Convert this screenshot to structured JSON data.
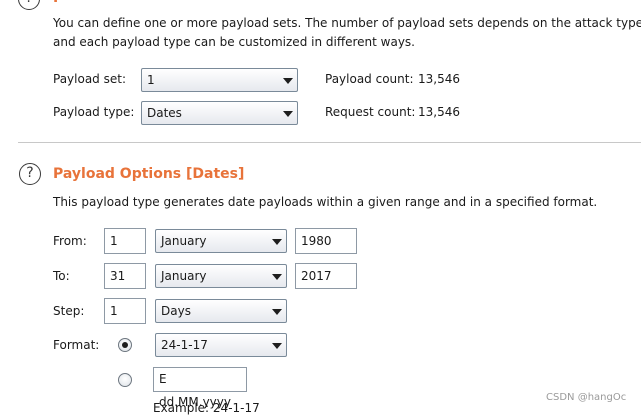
{
  "payload_sets": {
    "intro_line1": "You can define one or more payload sets. The number of payload sets depends on the attack type def",
    "intro_line2": "and each payload type can be customized in different ways.",
    "set_label": "Payload set:",
    "set_value": "1",
    "type_label": "Payload type:",
    "type_value": "Dates",
    "payload_count_label": "Payload count:",
    "payload_count": "13,546",
    "request_count_label": "Request count:",
    "request_count": "13,546"
  },
  "payload_options": {
    "help_glyph": "?",
    "title": "Payload Options [Dates]",
    "description": "This payload type generates date payloads within a given range and in a specified format.",
    "from_label": "From:",
    "from_day": "1",
    "from_month": "January",
    "from_year": "1980",
    "to_label": "To:",
    "to_day": "31",
    "to_month": "January",
    "to_year": "2017",
    "step_label": "Step:",
    "step_value": "1",
    "step_unit": "Days",
    "format_label": "Format:",
    "format_preset": "24-1-17",
    "format_custom": "E dd.MM.yyyy",
    "format_selected": "preset",
    "example": "Example: 24-1-17"
  },
  "watermark": "CSDN @hangOc"
}
